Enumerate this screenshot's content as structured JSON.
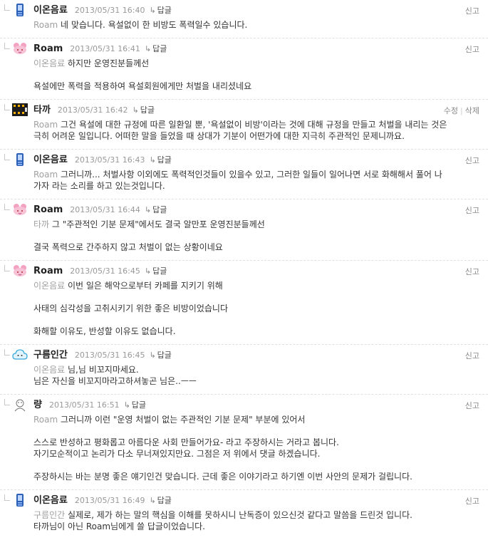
{
  "colors": {
    "text": "#333333",
    "muted": "#999999",
    "reply_target": "#a0a0a0",
    "divider": "#e0e0e0"
  },
  "comments": [
    {
      "nick": "이온음료",
      "date": "2013/05/31 16:40",
      "reply": "답글",
      "avatar": "phone-icon",
      "actions": [
        "신고"
      ],
      "lines": [
        {
          "to": "Roam",
          "text": " 네 맞습니다. 욕설없이 한 비방도 폭력일수 있습니다."
        }
      ]
    },
    {
      "nick": "Roam",
      "date": "2013/05/31 16:41",
      "reply": "답글",
      "avatar": "pink-character-icon",
      "actions": [
        "신고"
      ],
      "lines": [
        {
          "to": "이온음료",
          "text": " 하지만 운영진분들께선"
        },
        {
          "gap": true
        },
        {
          "text": "욕설에만 폭력을 적용하여 욕설회원에게만 처벌을 내리셨네요"
        }
      ]
    },
    {
      "nick": "타까",
      "date": "2013/05/31 16:42",
      "reply": "답글",
      "avatar": "film-strip-icon",
      "actions": [
        "수정",
        "삭제"
      ],
      "lines": [
        {
          "to": "Roam",
          "text": " 그건 욕설에 대한 규정에 따른 일환일 뿐, '욕설없이 비방'이라는 것에 대해 규정을 만들고 처벌을 내리는 것은"
        },
        {
          "text": "극히 어려운 일입니다. 어떠한 말을 들었을 때 상대가 기분이 어떤가에 대한 지극히 주관적인 문제니까요."
        }
      ]
    },
    {
      "nick": "이온음료",
      "date": "2013/05/31 16:43",
      "reply": "답글",
      "avatar": "phone-icon",
      "actions": [
        "신고"
      ],
      "lines": [
        {
          "to": "Roam",
          "text": " 그러니까... 처벌사항 이외에도 폭력적인것들이 있을수 있고, 그러한 일들이 일어나면 서로 화해해서 풀어 나"
        },
        {
          "text": "가자 라는 소리를 하고 있는것입니다."
        }
      ]
    },
    {
      "nick": "Roam",
      "date": "2013/05/31 16:44",
      "reply": "답글",
      "avatar": "pink-character-icon",
      "actions": [
        "신고"
      ],
      "lines": [
        {
          "to": "타까",
          "text": " 그 \"주관적인 기분 문제\"에서도 결국 알만포 운영진분들께선"
        },
        {
          "gap": true
        },
        {
          "text": "결국 폭력으로 간주하지 않고 처벌이 없는 상황이네요"
        }
      ]
    },
    {
      "nick": "Roam",
      "date": "2013/05/31 16:45",
      "reply": "답글",
      "avatar": "pink-character-icon",
      "actions": [
        "신고"
      ],
      "lines": [
        {
          "to": "이온음료",
          "text": " 이번 일은 해악으로부터 카페를 지키기 위해"
        },
        {
          "gap": true
        },
        {
          "text": "사태의 심각성을 고취시키기 위한 좋은 비방이었습니다"
        },
        {
          "gap": true
        },
        {
          "text": "화해할 이유도, 반성할 이유도 없습니다."
        }
      ]
    },
    {
      "nick": "구름인간",
      "date": "2013/05/31 16:45",
      "reply": "답글",
      "avatar": "cloud-icon",
      "actions": [
        "신고"
      ],
      "lines": [
        {
          "to": "이온음료",
          "text": " 님,님 비꼬지마세요."
        },
        {
          "text": "님은 자신을 비꼬지마라고하셔놓곤 님은..ㅡㅡ"
        }
      ]
    },
    {
      "nick": "량",
      "date": "2013/05/31 16:51",
      "reply": "답글",
      "avatar": "sketch-character-icon",
      "actions": [
        "신고"
      ],
      "lines": [
        {
          "to": "Roam",
          "text": " 그러니까 이런 \"운영 처벌이 없는 주관적인 기분 문제\" 부분에 있어서"
        },
        {
          "gap": true
        },
        {
          "text": "스스로 반성하고 평화롭고 아름다운 사회 만들어가요- 라고 주장하시는 거라고 봅니다."
        },
        {
          "text": "자기모순적이고 논리가 다소 무너져있지만요. 그점은 저 위에서 댓글 하겠습니다."
        },
        {
          "gap": true
        },
        {
          "text": "주장하시는 바는 분명 좋은 얘기인건 맞습니다. 근데 좋은 이야기라고 하기엔 이번 사안의 문제가 걸립니다."
        }
      ]
    },
    {
      "nick": "이온음료",
      "date": "2013/05/31 16:49",
      "reply": "답글",
      "avatar": "phone-icon",
      "actions": [
        "신고"
      ],
      "lines": [
        {
          "to": "구름인간",
          "text": " 실제로, 제가 하는 말의 핵심을 이해를 못하시니 난독증이 있으신것 같다고 말씀을 드린것 입니다."
        },
        {
          "text": "타까님이 아닌 Roam님에게 쓸 답글이었습니다."
        }
      ]
    }
  ]
}
